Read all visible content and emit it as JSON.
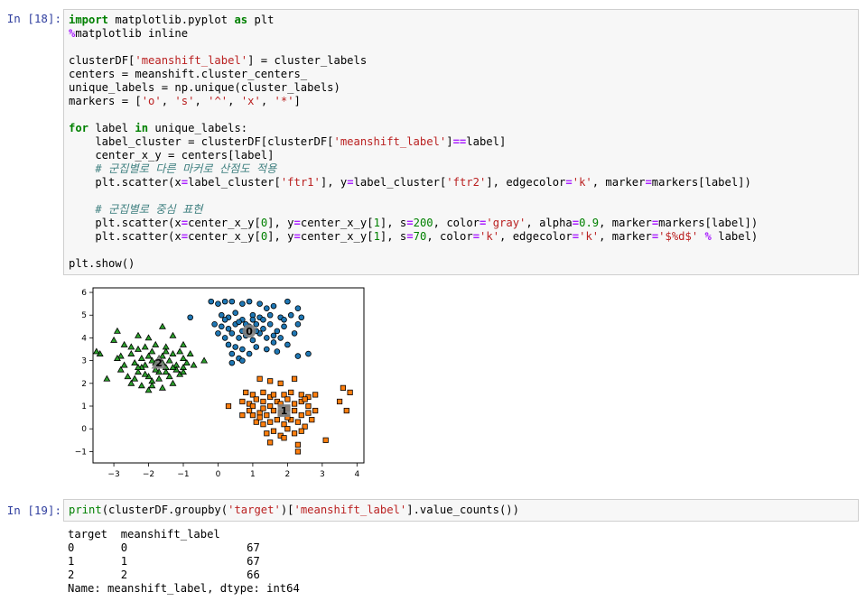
{
  "cell18": {
    "prompt": "In [18]:",
    "lines": [
      [
        {
          "t": "import",
          "c": "kw"
        },
        {
          "t": " matplotlib.pyplot "
        },
        {
          "t": "as",
          "c": "kw"
        },
        {
          "t": " plt"
        }
      ],
      [
        {
          "t": "%",
          "c": "mg"
        },
        {
          "t": "matplotlib inline"
        }
      ],
      [],
      [
        {
          "t": "clusterDF["
        },
        {
          "t": "'meanshift_label'",
          "c": "st"
        },
        {
          "t": "] = cluster_labels"
        }
      ],
      [
        {
          "t": "centers = meanshift.cluster_centers_"
        }
      ],
      [
        {
          "t": "unique_labels = np.unique(cluster_labels)"
        }
      ],
      [
        {
          "t": "markers = ["
        },
        {
          "t": "'o'",
          "c": "st"
        },
        {
          "t": ", "
        },
        {
          "t": "'s'",
          "c": "st"
        },
        {
          "t": ", "
        },
        {
          "t": "'^'",
          "c": "st"
        },
        {
          "t": ", "
        },
        {
          "t": "'x'",
          "c": "st"
        },
        {
          "t": ", "
        },
        {
          "t": "'*'",
          "c": "st"
        },
        {
          "t": "]"
        }
      ],
      [],
      [
        {
          "t": "for",
          "c": "kw"
        },
        {
          "t": " label "
        },
        {
          "t": "in",
          "c": "kw"
        },
        {
          "t": " unique_labels:"
        }
      ],
      [
        {
          "t": "    label_cluster = clusterDF[clusterDF["
        },
        {
          "t": "'meanshift_label'",
          "c": "st"
        },
        {
          "t": "]"
        },
        {
          "t": "==",
          "c": "op"
        },
        {
          "t": "label]"
        }
      ],
      [
        {
          "t": "    center_x_y = centers[label]"
        }
      ],
      [
        {
          "t": "    "
        },
        {
          "t": "# 군집별로 다른 마커로 산점도 적용",
          "c": "cm"
        }
      ],
      [
        {
          "t": "    plt.scatter(x"
        },
        {
          "t": "=",
          "c": "op"
        },
        {
          "t": "label_cluster["
        },
        {
          "t": "'ftr1'",
          "c": "st"
        },
        {
          "t": "], y"
        },
        {
          "t": "=",
          "c": "op"
        },
        {
          "t": "label_cluster["
        },
        {
          "t": "'ftr2'",
          "c": "st"
        },
        {
          "t": "], edgecolor"
        },
        {
          "t": "=",
          "c": "op"
        },
        {
          "t": "'k'",
          "c": "st"
        },
        {
          "t": ", marker"
        },
        {
          "t": "=",
          "c": "op"
        },
        {
          "t": "markers[label])"
        }
      ],
      [],
      [
        {
          "t": "    "
        },
        {
          "t": "# 군집별로 중심 표현",
          "c": "cm"
        }
      ],
      [
        {
          "t": "    plt.scatter(x"
        },
        {
          "t": "=",
          "c": "op"
        },
        {
          "t": "center_x_y["
        },
        {
          "t": "0",
          "c": "nu"
        },
        {
          "t": "], y"
        },
        {
          "t": "=",
          "c": "op"
        },
        {
          "t": "center_x_y["
        },
        {
          "t": "1",
          "c": "nu"
        },
        {
          "t": "], s"
        },
        {
          "t": "=",
          "c": "op"
        },
        {
          "t": "200",
          "c": "nu"
        },
        {
          "t": ", color"
        },
        {
          "t": "=",
          "c": "op"
        },
        {
          "t": "'gray'",
          "c": "st"
        },
        {
          "t": ", alpha"
        },
        {
          "t": "=",
          "c": "op"
        },
        {
          "t": "0.9",
          "c": "nu"
        },
        {
          "t": ", marker"
        },
        {
          "t": "=",
          "c": "op"
        },
        {
          "t": "markers[label])"
        }
      ],
      [
        {
          "t": "    plt.scatter(x"
        },
        {
          "t": "=",
          "c": "op"
        },
        {
          "t": "center_x_y["
        },
        {
          "t": "0",
          "c": "nu"
        },
        {
          "t": "], y"
        },
        {
          "t": "=",
          "c": "op"
        },
        {
          "t": "center_x_y["
        },
        {
          "t": "1",
          "c": "nu"
        },
        {
          "t": "], s"
        },
        {
          "t": "=",
          "c": "op"
        },
        {
          "t": "70",
          "c": "nu"
        },
        {
          "t": ", color"
        },
        {
          "t": "=",
          "c": "op"
        },
        {
          "t": "'k'",
          "c": "st"
        },
        {
          "t": ", edgecolor"
        },
        {
          "t": "=",
          "c": "op"
        },
        {
          "t": "'k'",
          "c": "st"
        },
        {
          "t": ", marker"
        },
        {
          "t": "=",
          "c": "op"
        },
        {
          "t": "'$%d$'",
          "c": "st"
        },
        {
          "t": " "
        },
        {
          "t": "%",
          "c": "op"
        },
        {
          "t": " label)"
        }
      ],
      [],
      [
        {
          "t": "plt.show()"
        }
      ]
    ]
  },
  "cell19": {
    "prompt": "In [19]:",
    "lines": [
      [
        {
          "t": "print",
          "c": "bi"
        },
        {
          "t": "(clusterDF.groupby("
        },
        {
          "t": "'target'",
          "c": "st"
        },
        {
          "t": ")["
        },
        {
          "t": "'meanshift_label'",
          "c": "st"
        },
        {
          "t": "].value_counts())"
        }
      ]
    ],
    "output": [
      "target  meanshift_label",
      "0       0                  67",
      "1       1                  67",
      "2       2                  66",
      "Name: meanshift_label, dtype: int64"
    ]
  },
  "chart_data": {
    "type": "scatter",
    "xlim": [
      -3.6,
      4.2
    ],
    "ylim": [
      -1.5,
      6.2
    ],
    "xticks": [
      -3,
      -2,
      -1,
      0,
      1,
      2,
      3,
      4
    ],
    "yticks": [
      -1,
      0,
      1,
      2,
      3,
      4,
      5,
      6
    ],
    "grid": false,
    "colors": {
      "0": "#1f77b4",
      "1": "#ff7f0e",
      "2": "#2ca02c",
      "center": "#808080"
    },
    "series": [
      {
        "marker": "o",
        "points": [
          [
            -0.2,
            5.6
          ],
          [
            0.0,
            5.5
          ],
          [
            0.2,
            5.6
          ],
          [
            0.4,
            5.6
          ],
          [
            0.7,
            5.5
          ],
          [
            0.9,
            5.6
          ],
          [
            1.2,
            5.5
          ],
          [
            1.4,
            5.3
          ],
          [
            1.6,
            5.4
          ],
          [
            2.0,
            5.6
          ],
          [
            2.3,
            5.3
          ],
          [
            -0.8,
            4.9
          ],
          [
            0.1,
            5.0
          ],
          [
            0.3,
            4.9
          ],
          [
            0.5,
            5.1
          ],
          [
            0.7,
            4.8
          ],
          [
            1.0,
            5.0
          ],
          [
            1.2,
            4.9
          ],
          [
            1.5,
            5.0
          ],
          [
            1.8,
            4.9
          ],
          [
            2.1,
            5.0
          ],
          [
            2.4,
            4.9
          ],
          [
            -0.1,
            4.6
          ],
          [
            0.1,
            4.5
          ],
          [
            0.3,
            4.4
          ],
          [
            0.5,
            4.6
          ],
          [
            0.7,
            4.3
          ],
          [
            0.9,
            4.5
          ],
          [
            1.1,
            4.6
          ],
          [
            1.3,
            4.4
          ],
          [
            1.5,
            4.6
          ],
          [
            1.7,
            4.3
          ],
          [
            1.9,
            4.5
          ],
          [
            2.2,
            4.2
          ],
          [
            0.0,
            4.2
          ],
          [
            0.2,
            4.0
          ],
          [
            0.4,
            4.2
          ],
          [
            0.6,
            4.0
          ],
          [
            0.8,
            4.1
          ],
          [
            1.0,
            3.9
          ],
          [
            1.2,
            4.2
          ],
          [
            1.4,
            4.0
          ],
          [
            1.6,
            3.8
          ],
          [
            1.8,
            4.0
          ],
          [
            2.0,
            3.7
          ],
          [
            0.3,
            3.7
          ],
          [
            0.5,
            3.6
          ],
          [
            0.7,
            3.5
          ],
          [
            1.1,
            3.6
          ],
          [
            1.4,
            3.5
          ],
          [
            1.7,
            3.4
          ],
          [
            0.4,
            3.3
          ],
          [
            0.6,
            3.1
          ],
          [
            0.9,
            3.3
          ],
          [
            2.6,
            3.3
          ],
          [
            0.4,
            2.9
          ],
          [
            0.7,
            3.0
          ],
          [
            2.3,
            3.2
          ],
          [
            0.8,
            4.6
          ],
          [
            1.1,
            4.3
          ],
          [
            1.3,
            4.8
          ],
          [
            0.6,
            4.7
          ],
          [
            1.6,
            4.1
          ],
          [
            0.2,
            4.8
          ],
          [
            1.9,
            4.8
          ],
          [
            2.3,
            4.6
          ],
          [
            1.0,
            4.8
          ]
        ],
        "center": [
          0.9,
          4.3
        ]
      },
      {
        "marker": "s",
        "points": [
          [
            1.2,
            2.2
          ],
          [
            1.5,
            2.1
          ],
          [
            1.8,
            2.0
          ],
          [
            2.2,
            2.2
          ],
          [
            0.8,
            1.6
          ],
          [
            1.0,
            1.5
          ],
          [
            1.3,
            1.6
          ],
          [
            1.5,
            1.4
          ],
          [
            1.9,
            1.5
          ],
          [
            2.1,
            1.6
          ],
          [
            2.4,
            1.5
          ],
          [
            2.6,
            1.4
          ],
          [
            2.8,
            1.5
          ],
          [
            3.6,
            1.8
          ],
          [
            3.8,
            1.6
          ],
          [
            0.7,
            1.2
          ],
          [
            0.9,
            1.1
          ],
          [
            1.1,
            1.3
          ],
          [
            1.3,
            1.2
          ],
          [
            1.5,
            1.0
          ],
          [
            1.7,
            1.2
          ],
          [
            2.0,
            1.3
          ],
          [
            2.2,
            1.1
          ],
          [
            2.4,
            1.2
          ],
          [
            2.6,
            1.0
          ],
          [
            3.5,
            1.2
          ],
          [
            0.7,
            0.6
          ],
          [
            1.0,
            0.6
          ],
          [
            1.2,
            0.7
          ],
          [
            1.4,
            0.6
          ],
          [
            1.6,
            0.8
          ],
          [
            1.8,
            0.7
          ],
          [
            2.0,
            0.9
          ],
          [
            2.2,
            0.8
          ],
          [
            2.4,
            0.6
          ],
          [
            2.6,
            0.7
          ],
          [
            3.7,
            0.8
          ],
          [
            0.3,
            1.0
          ],
          [
            1.1,
            0.3
          ],
          [
            1.3,
            0.2
          ],
          [
            1.5,
            0.3
          ],
          [
            1.7,
            0.4
          ],
          [
            1.9,
            0.2
          ],
          [
            2.1,
            0.4
          ],
          [
            2.3,
            0.3
          ],
          [
            2.5,
            0.1
          ],
          [
            2.7,
            0.4
          ],
          [
            1.4,
            -0.2
          ],
          [
            1.6,
            -0.1
          ],
          [
            1.8,
            -0.3
          ],
          [
            2.0,
            0.0
          ],
          [
            2.2,
            -0.2
          ],
          [
            2.4,
            -0.1
          ],
          [
            1.5,
            -0.6
          ],
          [
            1.9,
            -0.4
          ],
          [
            2.3,
            -0.7
          ],
          [
            3.1,
            -0.5
          ],
          [
            2.3,
            -1.0
          ],
          [
            1.0,
            1.0
          ],
          [
            1.3,
            0.9
          ],
          [
            1.8,
            1.1
          ],
          [
            2.0,
            0.5
          ],
          [
            1.2,
            0.5
          ],
          [
            2.8,
            0.8
          ],
          [
            1.6,
            1.5
          ],
          [
            0.9,
            0.8
          ],
          [
            2.5,
            1.3
          ]
        ],
        "center": [
          1.9,
          0.8
        ]
      },
      {
        "marker": "^",
        "points": [
          [
            -2.9,
            4.3
          ],
          [
            -1.6,
            4.5
          ],
          [
            -2.3,
            4.1
          ],
          [
            -2.0,
            4.0
          ],
          [
            -1.3,
            4.1
          ],
          [
            -3.0,
            3.9
          ],
          [
            -2.7,
            3.7
          ],
          [
            -2.1,
            3.6
          ],
          [
            -1.8,
            3.7
          ],
          [
            -1.5,
            3.6
          ],
          [
            -1.0,
            3.7
          ],
          [
            -3.4,
            3.3
          ],
          [
            -2.8,
            3.2
          ],
          [
            -2.5,
            3.3
          ],
          [
            -2.2,
            3.1
          ],
          [
            -1.9,
            3.4
          ],
          [
            -1.6,
            3.2
          ],
          [
            -1.3,
            3.3
          ],
          [
            -1.0,
            3.1
          ],
          [
            -0.8,
            3.3
          ],
          [
            -3.5,
            3.4
          ],
          [
            -2.9,
            3.1
          ],
          [
            -2.4,
            2.9
          ],
          [
            -2.1,
            2.8
          ],
          [
            -1.8,
            2.9
          ],
          [
            -1.5,
            2.7
          ],
          [
            -1.2,
            2.8
          ],
          [
            -1.0,
            2.7
          ],
          [
            -0.7,
            2.8
          ],
          [
            -0.4,
            3.0
          ],
          [
            -2.8,
            2.6
          ],
          [
            -2.3,
            2.5
          ],
          [
            -2.0,
            2.3
          ],
          [
            -1.7,
            2.5
          ],
          [
            -1.4,
            2.3
          ],
          [
            -1.1,
            2.4
          ],
          [
            -3.2,
            2.2
          ],
          [
            -2.5,
            2.0
          ],
          [
            -2.2,
            1.9
          ],
          [
            -1.9,
            2.1
          ],
          [
            -1.6,
            1.8
          ],
          [
            -1.3,
            2.0
          ],
          [
            -2.0,
            1.7
          ],
          [
            -1.7,
            2.2
          ],
          [
            -2.6,
            2.3
          ],
          [
            -1.4,
            3.0
          ],
          [
            -1.9,
            3.0
          ],
          [
            -2.3,
            3.5
          ],
          [
            -1.1,
            3.4
          ],
          [
            -2.7,
            2.8
          ],
          [
            -1.5,
            2.5
          ],
          [
            -2.1,
            2.4
          ],
          [
            -1.8,
            2.6
          ],
          [
            -1.2,
            2.6
          ],
          [
            -2.4,
            2.2
          ],
          [
            -0.9,
            2.9
          ],
          [
            -2.0,
            3.2
          ],
          [
            -1.6,
            2.9
          ],
          [
            -1.3,
            2.7
          ],
          [
            -2.2,
            2.7
          ],
          [
            -1.7,
            3.1
          ],
          [
            -2.5,
            3.6
          ],
          [
            -1.0,
            2.5
          ],
          [
            -1.9,
            1.9
          ],
          [
            -2.3,
            2.7
          ],
          [
            -1.5,
            3.4
          ]
        ],
        "center": [
          -1.7,
          2.9
        ]
      }
    ],
    "center_labels": [
      "0",
      "1",
      "2"
    ]
  }
}
